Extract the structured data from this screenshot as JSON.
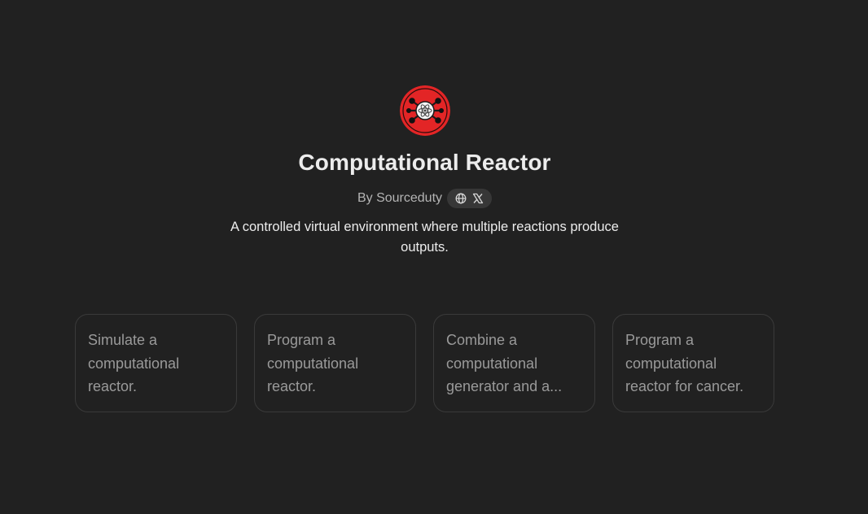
{
  "gpt": {
    "title": "Computational Reactor",
    "byline": "By Sourceduty",
    "description": "A controlled virtual environment where multiple reactions produce outputs.",
    "logo_icon": "reactor-atom-logo-icon",
    "social_icons": [
      "globe-icon",
      "x-icon"
    ]
  },
  "conversation_starters": [
    {
      "text": "Simulate a computational reactor."
    },
    {
      "text": "Program a computational reactor."
    },
    {
      "text": "Combine a computational generator and a..."
    },
    {
      "text": "Program a computational reactor for cancer."
    }
  ],
  "colors": {
    "background": "#212121",
    "logo_red": "#e32526",
    "card_border": "#3a3a3a",
    "muted_text": "#9a9a9a"
  }
}
